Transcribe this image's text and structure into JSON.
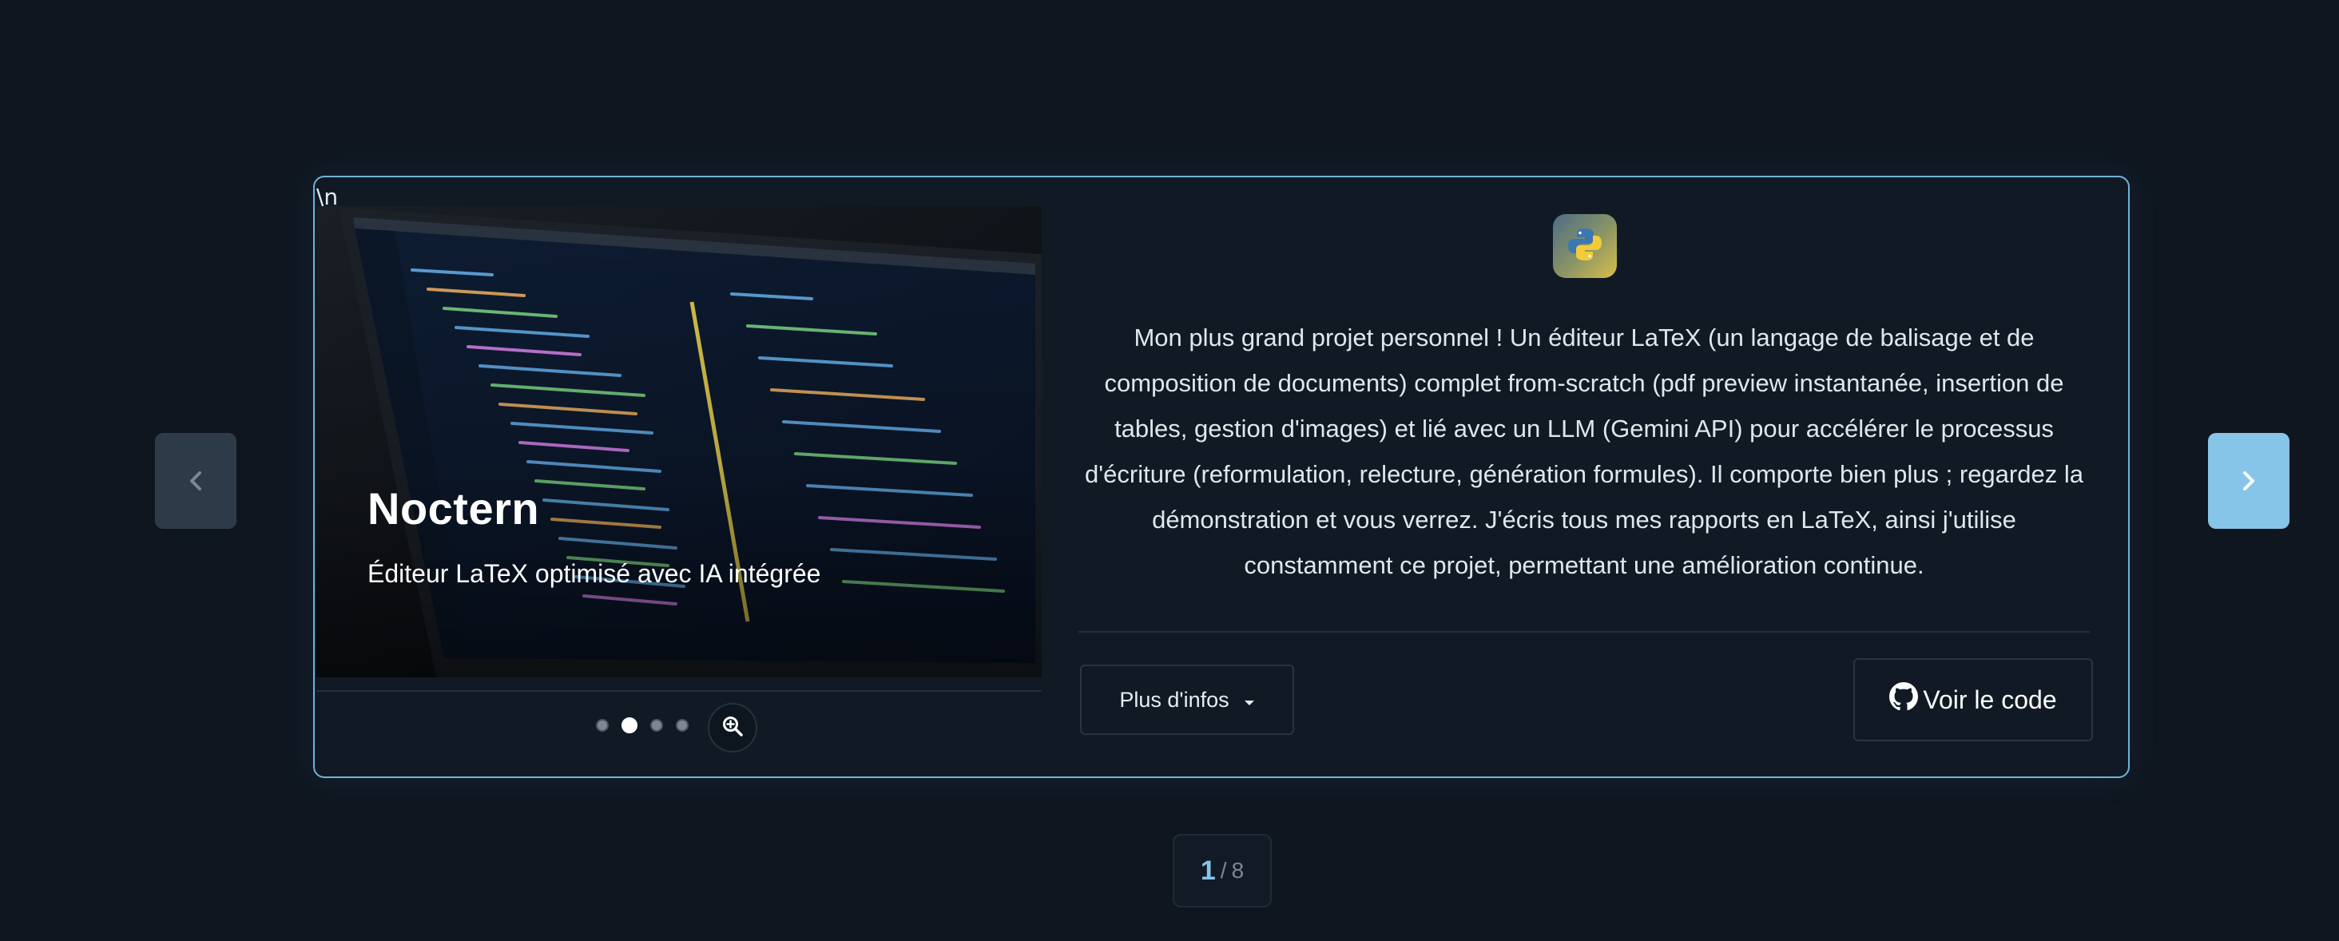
{
  "navigation": {
    "prev_icon": "chevron-left-icon",
    "next_icon": "chevron-right-icon"
  },
  "card": {
    "stray_text": "\\n",
    "image": {
      "title": "Noctern",
      "subtitle": "Éditeur LaTeX optimisé avec IA intégrée"
    },
    "carousel": {
      "slide_count": 4,
      "active_index": 1,
      "zoom_icon": "zoom-in-icon"
    },
    "language_icon": "python-icon",
    "description": "Mon plus grand projet personnel ! Un éditeur LaTeX (un langage de balisage et de composition de documents) complet from-scratch (pdf preview instantanée, insertion de tables, gestion d'images) et lié avec un LLM (Gemini API) pour accélérer le processus d'écriture (reformulation, relecture, génération formules). Il comporte bien plus ; regardez la démonstration et vous verrez. J'écris tous mes rapports en LaTeX, ainsi j'utilise constamment ce projet, permettant une amélioration continue.",
    "more_info_label": "Plus d'infos",
    "view_code_label": "Voir le code",
    "view_code_icon": "github-icon"
  },
  "pagination": {
    "current": "1",
    "separator": "/",
    "total": "8"
  },
  "colors": {
    "background": "#0f1620",
    "accent": "#86c5e8",
    "card_border": "#6fb4d8"
  }
}
